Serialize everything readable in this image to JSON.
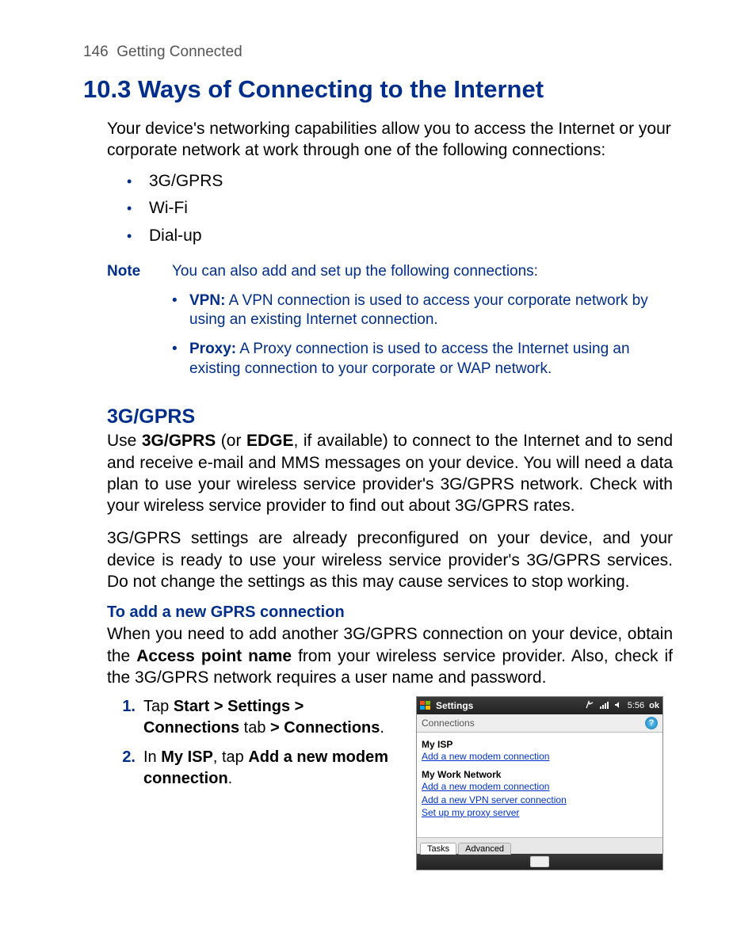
{
  "header": {
    "page_number": "146",
    "chapter": "Getting Connected"
  },
  "h1": "10.3  Ways of Connecting to the Internet",
  "intro": "Your device's networking capabilities allow you to access the Internet or your corporate network at work through one of the following connections:",
  "bullets": [
    "3G/GPRS",
    "Wi-Fi",
    "Dial-up"
  ],
  "note": {
    "label": "Note",
    "lead": "You can also add and set up the following connections:",
    "items": [
      {
        "term": "VPN:",
        "text": " A VPN connection is used to access your corporate network by using an existing Internet connection."
      },
      {
        "term": "Proxy:",
        "text": " A Proxy connection is used to access the Internet using an existing connection to your corporate or WAP network."
      }
    ]
  },
  "h2": "3G/GPRS",
  "p1": {
    "pre": "Use ",
    "b1": "3G/GPRS",
    "mid1": " (or ",
    "b2": "EDGE",
    "mid2": ", if available) to connect to the Internet and to send and receive e-mail and MMS messages on your device. You will need a data plan to use your wireless service provider's 3G/GPRS network. Check with your wireless service provider to find out about 3G/GPRS rates."
  },
  "p2": "3G/GPRS settings are already preconfigured on your device, and your device is ready to use your wireless service provider's 3G/GPRS services. Do not change the settings as this may cause services to stop working.",
  "h3": "To add a new GPRS connection",
  "p3": {
    "pre": "When you need to add another 3G/GPRS connection on your device, obtain the ",
    "b1": "Access point name",
    "post": " from your wireless service provider. Also, check if the 3G/GPRS network requires a user name and password."
  },
  "steps": [
    {
      "num": "1.",
      "parts": [
        "Tap ",
        "Start > Settings > Connections",
        " tab ",
        "> Connections",
        "."
      ]
    },
    {
      "num": "2.",
      "parts": [
        "In ",
        "My ISP",
        ", tap ",
        "Add a new modem connection",
        "."
      ]
    }
  ],
  "shot": {
    "title": "Settings",
    "time": "5:56",
    "ok": "ok",
    "subbar": "Connections",
    "group1": "My ISP",
    "link1": "Add a new modem connection",
    "group2": "My Work Network",
    "link2": "Add a new modem connection",
    "link3": "Add a new VPN server connection",
    "link4": "Set up my proxy server",
    "tab1": "Tasks",
    "tab2": "Advanced"
  }
}
